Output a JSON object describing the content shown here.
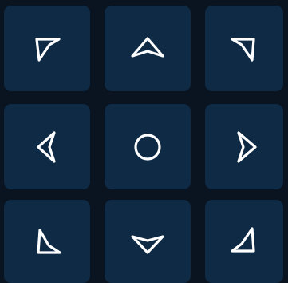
{
  "colors": {
    "background": "#0a1420",
    "button": "#0e2a45",
    "glyph": "#ffffff"
  },
  "dpad": {
    "buttons": [
      {
        "name": "up-left-button",
        "icon": "arrow-up-left-icon"
      },
      {
        "name": "up-button",
        "icon": "arrow-up-icon"
      },
      {
        "name": "up-right-button",
        "icon": "arrow-up-right-icon"
      },
      {
        "name": "left-button",
        "icon": "arrow-left-icon"
      },
      {
        "name": "center-button",
        "icon": "circle-icon"
      },
      {
        "name": "right-button",
        "icon": "arrow-right-icon"
      },
      {
        "name": "down-left-button",
        "icon": "arrow-down-left-icon"
      },
      {
        "name": "down-button",
        "icon": "arrow-down-icon"
      },
      {
        "name": "down-right-button",
        "icon": "arrow-down-right-icon"
      }
    ]
  }
}
